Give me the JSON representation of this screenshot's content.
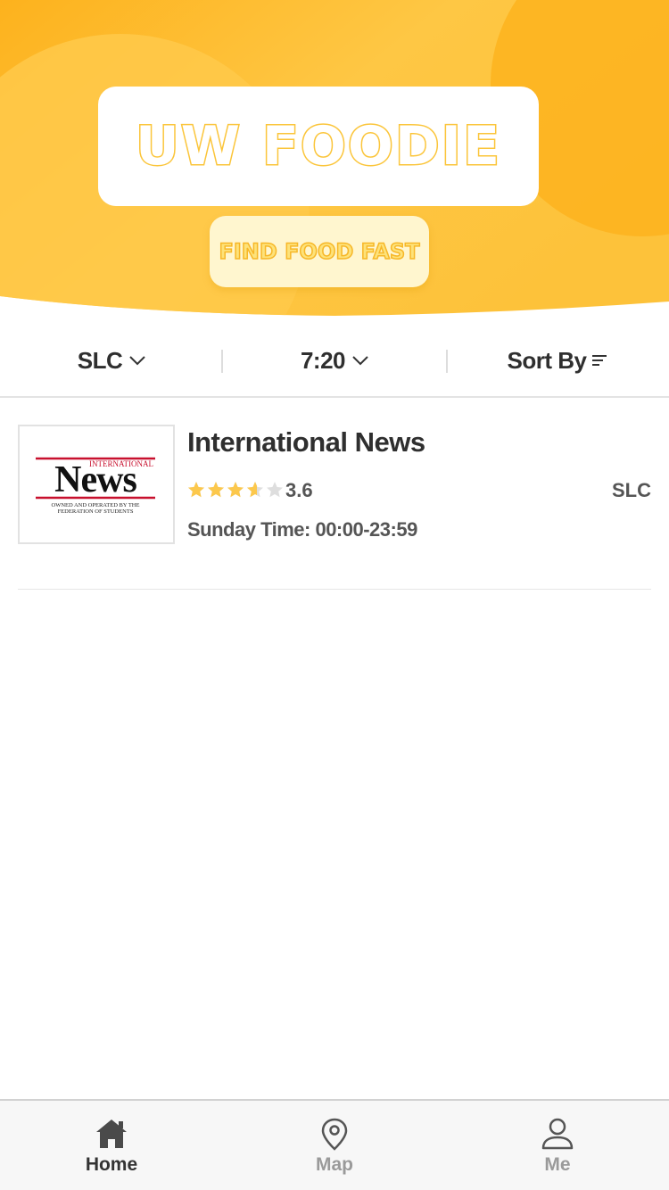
{
  "app": {
    "title": "UW FOODIE",
    "tagline": "FIND FOOD FAST"
  },
  "colors": {
    "brand_yellow": "#fbc53a",
    "brand_orange": "#fdb21d",
    "star_filled": "#fcc84c",
    "star_empty": "#dedede",
    "text_dark": "#2f2f2f"
  },
  "filters": {
    "location": {
      "label": "SLC",
      "icon": "chevron-down-icon"
    },
    "time": {
      "label": "7:20",
      "icon": "chevron-down-icon"
    },
    "sort": {
      "label": "Sort By",
      "icon": "sort-lines-icon"
    }
  },
  "restaurants": [
    {
      "name": "International News",
      "rating": 3.6,
      "rating_text": "3.6",
      "rating_max": 5,
      "area": "SLC",
      "hours": "Sunday Time: 00:00-23:59",
      "logo": {
        "top_text": "INTERNATIONAL",
        "main_text": "News",
        "sub_line1": "OWNED AND OPERATED BY THE",
        "sub_line2": "FEDERATION OF STUDENTS"
      }
    }
  ],
  "tabs": [
    {
      "label": "Home",
      "icon": "home-icon",
      "active": true
    },
    {
      "label": "Map",
      "icon": "map-pin-icon",
      "active": false
    },
    {
      "label": "Me",
      "icon": "user-icon",
      "active": false
    }
  ]
}
